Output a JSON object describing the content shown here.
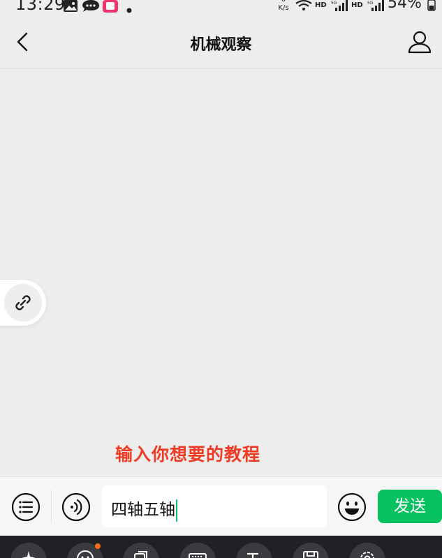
{
  "status_bar": {
    "time": "13:29",
    "net_speed_value": "0",
    "net_speed_unit": "K/s",
    "hd1": "HD",
    "hd2": "HD",
    "battery": "54%"
  },
  "nav": {
    "title": "机械观察"
  },
  "hint": {
    "text": "输入你想要的教程"
  },
  "input_bar": {
    "input_value": "四轴五轴",
    "send_label": "发送"
  },
  "colors": {
    "accent_green": "#07c160",
    "hint_red": "#ee3b24",
    "notification_dot": "#f26b1d"
  },
  "icons": [
    "back-icon",
    "profile-icon",
    "link-icon",
    "menu-list-icon",
    "voice-icon",
    "emoji-icon",
    "sparkle-icon",
    "smiley-icon",
    "clipboard-icon",
    "keyboard-icon",
    "text-icon",
    "save-icon",
    "settings-icon"
  ]
}
